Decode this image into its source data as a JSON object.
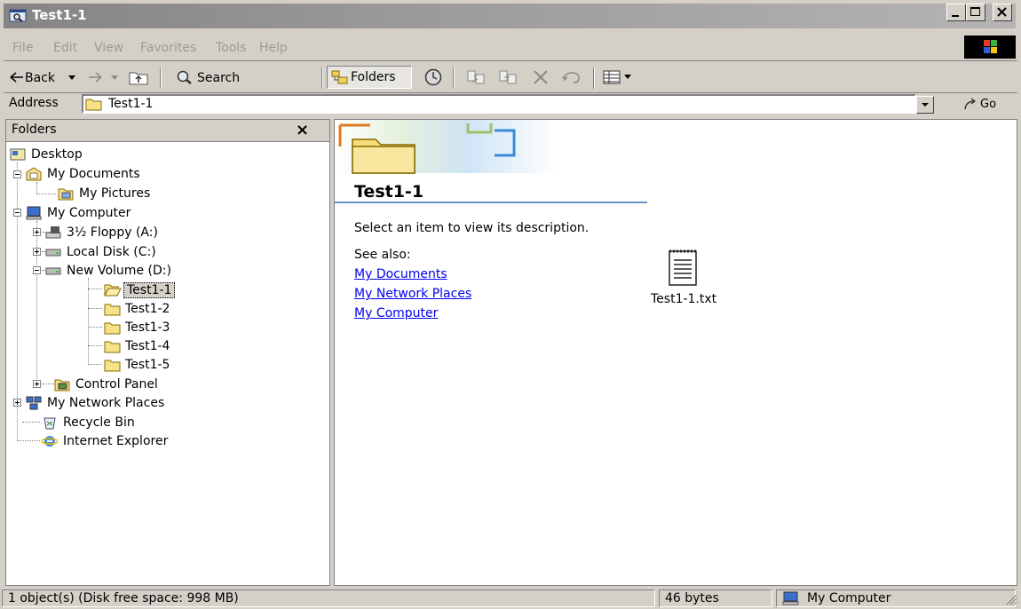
{
  "window": {
    "title": "Test1-1",
    "minimize_label": "_",
    "maximize_label": "□",
    "close_label": "×"
  },
  "menu": [
    "File",
    "Edit",
    "View",
    "Favorites",
    "Tools",
    "Help"
  ],
  "toolbar": {
    "back_label": "Back",
    "search_label": "Search",
    "folders_label": "Folders"
  },
  "address": {
    "label": "Address",
    "value": "Test1-1",
    "go_label": "Go"
  },
  "folders_pane": {
    "title": "Folders",
    "close_label": "×",
    "items": [
      {
        "label": "Desktop",
        "icon": "desktop-icon"
      },
      {
        "label": "My Documents",
        "icon": "my-documents-icon"
      },
      {
        "label": "My Pictures",
        "icon": "my-pictures-icon"
      },
      {
        "label": "My Computer",
        "icon": "my-computer-icon"
      },
      {
        "label": "3½ Floppy (A:)",
        "icon": "floppy-drive-icon"
      },
      {
        "label": "Local Disk (C:)",
        "icon": "hard-disk-icon"
      },
      {
        "label": "New Volume (D:)",
        "icon": "hard-disk-icon"
      },
      {
        "label": "Test1-1",
        "icon": "open-folder-icon",
        "selected": true
      },
      {
        "label": "Test1-2",
        "icon": "folder-icon"
      },
      {
        "label": "Test1-3",
        "icon": "folder-icon"
      },
      {
        "label": "Test1-4",
        "icon": "folder-icon"
      },
      {
        "label": "Test1-5",
        "icon": "folder-icon"
      },
      {
        "label": "Control Panel",
        "icon": "control-panel-icon"
      },
      {
        "label": "My Network Places",
        "icon": "network-places-icon"
      },
      {
        "label": "Recycle Bin",
        "icon": "recycle-bin-icon"
      },
      {
        "label": "Internet Explorer",
        "icon": "internet-explorer-icon"
      }
    ]
  },
  "content": {
    "folder_title": "Test1-1",
    "description": "Select an item to view its description.",
    "see_also_label": "See also:",
    "links": [
      "My Documents",
      "My Network Places",
      "My Computer"
    ],
    "files": [
      {
        "name": "Test1-1.txt",
        "icon": "text-file-icon"
      }
    ]
  },
  "status": {
    "objects": "1 object(s) (Disk free space: 998 MB)",
    "size": "46 bytes",
    "zone": "My Computer"
  },
  "colors": {
    "title_bar": "#9a9a9a",
    "selection": "#d4d0c8",
    "link": "#0000ee",
    "header_line": "#6b92c7"
  }
}
